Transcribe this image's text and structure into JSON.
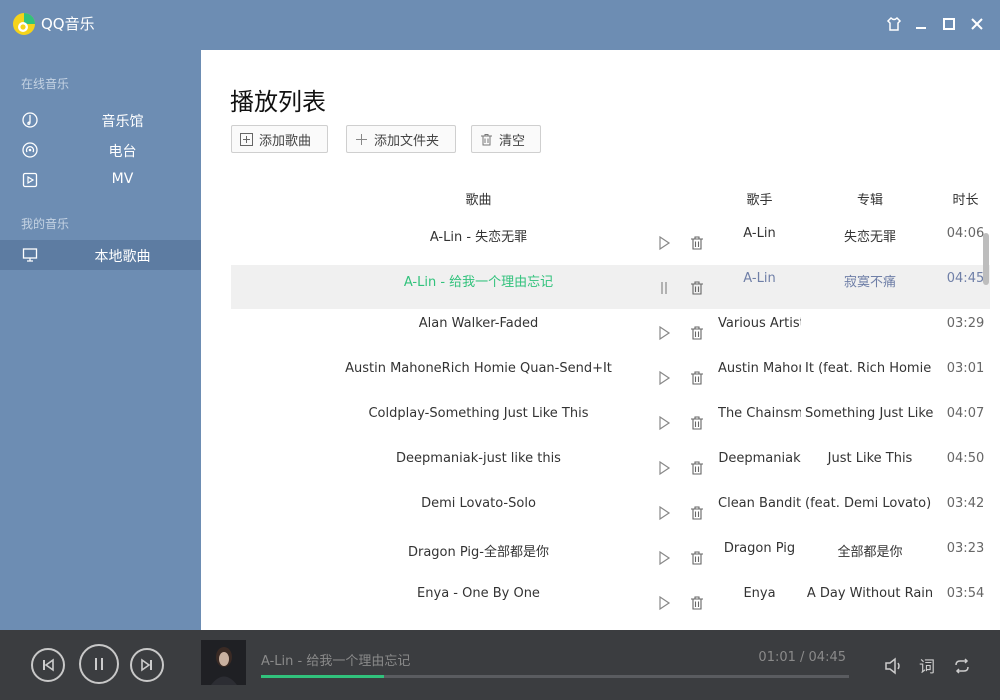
{
  "app": {
    "title": "QQ音乐"
  },
  "sidebar": {
    "online_label": "在线音乐",
    "mine_label": "我的音乐",
    "items": [
      {
        "label": "音乐馆",
        "icon": "music-hall-icon"
      },
      {
        "label": "电台",
        "icon": "radio-icon"
      },
      {
        "label": "MV",
        "icon": "mv-icon"
      },
      {
        "label": "本地歌曲",
        "icon": "monitor-icon",
        "active": true
      }
    ]
  },
  "main": {
    "title": "播放列表",
    "toolbar": {
      "add_song": "添加歌曲",
      "add_folder": "添加文件夹",
      "clear": "清空"
    },
    "columns": {
      "song": "歌曲",
      "artist": "歌手",
      "album": "专辑",
      "duration": "时长"
    },
    "rows": [
      {
        "song": "A-Lin - 失恋无罪",
        "artist": "A-Lin",
        "album": "失恋无罪",
        "duration": "04:06"
      },
      {
        "song": "A-Lin - 给我一个理由忘记",
        "artist": "A-Lin",
        "album": "寂寞不痛",
        "duration": "04:45",
        "playing": true
      },
      {
        "song": "Alan Walker-Faded",
        "artist": "Various Artist",
        "album": "",
        "duration": "03:29"
      },
      {
        "song": "Austin MahoneRich Homie Quan-Send+It",
        "artist": "Austin Mahone",
        "album": "It (feat. Rich Homie C",
        "duration": "03:01"
      },
      {
        "song": "Coldplay-Something Just Like This",
        "artist": "The Chainsmokers",
        "album": "Something Just Like Thi",
        "duration": "04:07"
      },
      {
        "song": "Deepmaniak-just like this",
        "artist": "Deepmaniak",
        "album": "Just Like This",
        "duration": "04:50"
      },
      {
        "song": "Demi Lovato-Solo",
        "artist": "Clean Bandit",
        "album": "(feat. Demi Lovato) -",
        "duration": "03:42"
      },
      {
        "song": "Dragon Pig-全部都是你",
        "artist": "Dragon Pig",
        "album": "全部都是你",
        "duration": "03:23"
      },
      {
        "song": "Enya - One By One",
        "artist": "Enya",
        "album": "A Day Without Rain",
        "duration": "03:54"
      }
    ]
  },
  "player": {
    "now_playing": "A-Lin - 给我一个理由忘记",
    "time": "01:01 / 04:45",
    "progress": 0.21,
    "accent_color": "#31c27c"
  }
}
